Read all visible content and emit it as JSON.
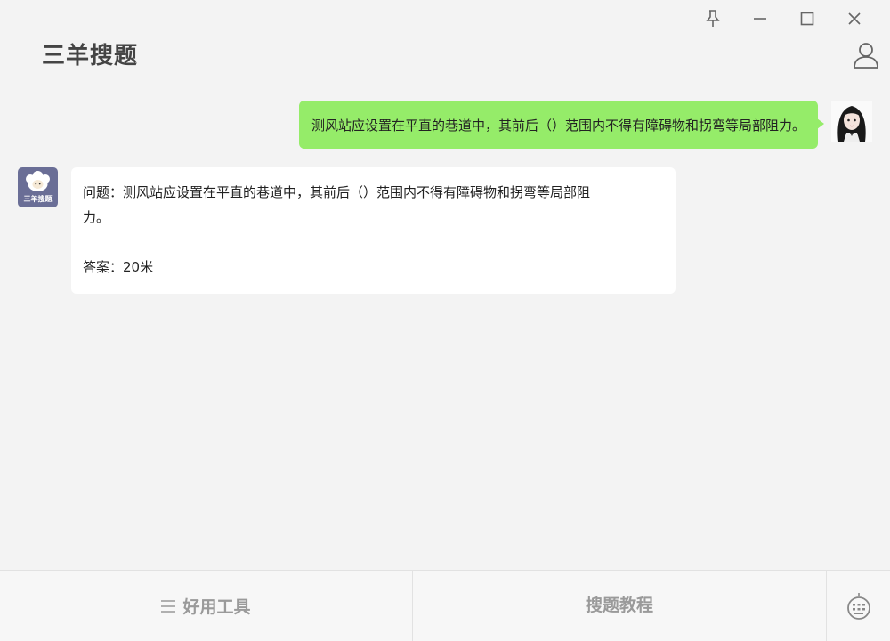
{
  "window": {
    "controls": [
      "pin",
      "minimize",
      "maximize",
      "close"
    ]
  },
  "header": {
    "title": "三羊搜题"
  },
  "conversation": {
    "user_message": "测风站应设置在平直的巷道中，其前后（）范围内不得有障碍物和拐弯等局部阻力。",
    "bot_avatar_label": "三羊搜题",
    "bot_message": {
      "question_line1": "问题：测风站应设置在平直的巷道中，其前后（）范围内不得有障碍物和拐弯等局部阻",
      "question_line2": "力。",
      "answer": "答案：20米"
    }
  },
  "bottom_bar": {
    "tools_label": "好用工具",
    "tutorial_label": "搜题教程"
  },
  "colors": {
    "user_bubble": "#95ec69",
    "bot_avatar_bg": "#6a6e96",
    "background": "#f3f3f3"
  }
}
